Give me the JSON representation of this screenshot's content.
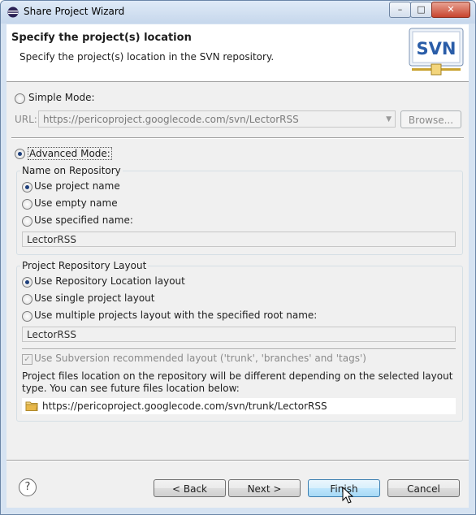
{
  "window": {
    "title": "Share Project Wizard",
    "controls": [
      "–",
      "□",
      "✕"
    ]
  },
  "header": {
    "title": "Specify the project(s) location",
    "description": "Specify the project(s) location in the SVN repository.",
    "logo_text": "SVN"
  },
  "simple_mode": {
    "label": "Simple Mode:",
    "url_label": "URL:",
    "url_value": "https://pericoproject.googlecode.com/svn/LectorRSS",
    "browse_label": "Browse...",
    "selected": false
  },
  "advanced_mode": {
    "label": "Advanced Mode:",
    "selected": true
  },
  "name_on_repository": {
    "title": "Name on Repository",
    "options": [
      "Use project name",
      "Use empty name",
      "Use specified name:"
    ],
    "selected_index": 0,
    "specified_name": "LectorRSS"
  },
  "project_repository_layout": {
    "title": "Project Repository Layout",
    "options": [
      "Use Repository Location layout",
      "Use single project layout",
      "Use multiple projects layout with the specified root name:"
    ],
    "selected_index": 0,
    "root_name": "LectorRSS",
    "recommended_layout_label": "Use Subversion recommended layout ('trunk', 'branches' and 'tags')",
    "recommended_layout_checked": true,
    "info_text": "Project files location on the repository will be different depending on the selected layout type. You can see future files location below:",
    "future_location": "https://pericoproject.googlecode.com/svn/trunk/LectorRSS"
  },
  "footer": {
    "help_symbol": "?",
    "back_label": "< Back",
    "next_label": "Next >",
    "finish_label": "Finish",
    "cancel_label": "Cancel"
  },
  "colors": {
    "accent": "#1d3f7c",
    "svn_blue": "#2a5da8",
    "folder_yellow": "#e8b84a"
  }
}
